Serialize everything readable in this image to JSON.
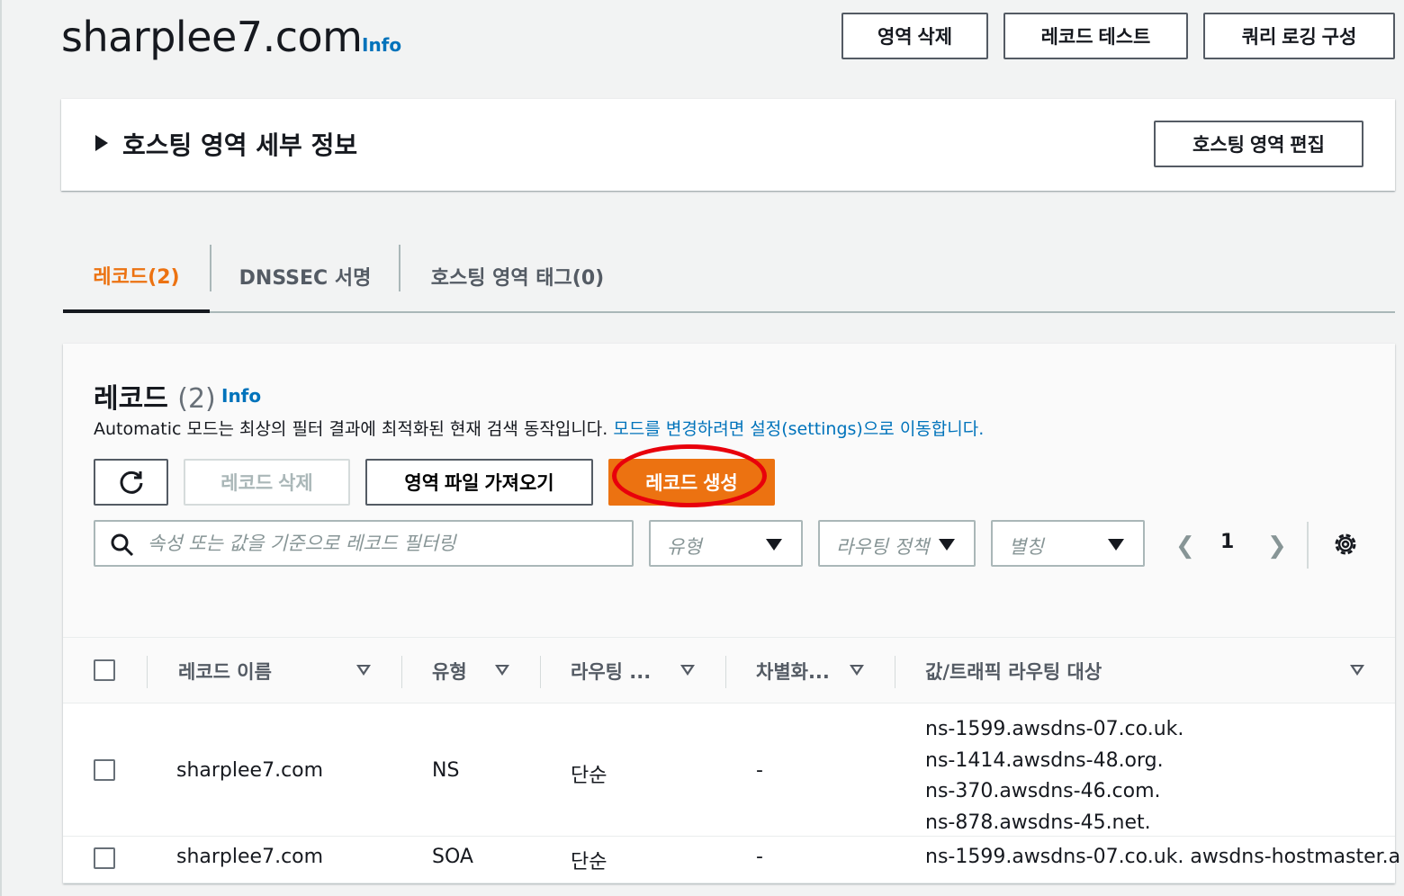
{
  "header": {
    "title": "sharplee7.com",
    "info": "Info",
    "buttons": {
      "delete_zone": "영역 삭제",
      "test_record": "레코드 테스트",
      "query_logging": "쿼리 로깅 구성"
    }
  },
  "details": {
    "title": "호스팅 영역 세부 정보",
    "edit_button": "호스팅 영역 편집"
  },
  "tabs": [
    {
      "label": "레코드(2)",
      "active": true
    },
    {
      "label": "DNSSEC 서명",
      "active": false
    },
    {
      "label": "호스팅 영역 태그(0)",
      "active": false
    }
  ],
  "records": {
    "heading": "레코드",
    "count": "(2)",
    "info": "Info",
    "description": "Automatic 모드는 최상의 필터 결과에 최적화된 현재 검색 동작입니다. ",
    "description_link": "모드를 변경하려면 설정(settings)으로 이동합니다.",
    "buttons": {
      "delete": "레코드 삭제",
      "import": "영역 파일 가져오기",
      "create": "레코드 생성"
    },
    "search_placeholder": "속성 또는 값을 기준으로 레코드 필터링",
    "filters": {
      "type": "유형",
      "routing": "라우팅 정책",
      "alias": "별칭"
    },
    "pager": {
      "page": "1"
    },
    "columns": {
      "name": "레코드 이름",
      "type": "유형",
      "routing": "라우팅 ...",
      "differentiator": "차별화...",
      "value": "값/트래픽 라우팅 대상"
    },
    "rows": [
      {
        "name": "sharplee7.com",
        "type": "NS",
        "routing": "단순",
        "differentiator": "-",
        "values": [
          "ns-1599.awsdns-07.co.uk.",
          "ns-1414.awsdns-48.org.",
          "ns-370.awsdns-46.com.",
          "ns-878.awsdns-45.net."
        ]
      },
      {
        "name": "sharplee7.com",
        "type": "SOA",
        "routing": "단순",
        "differentiator": "-",
        "value": "ns-1599.awsdns-07.co.uk. awsdns-hostmaster.a"
      }
    ]
  },
  "colors": {
    "accent": "#ec7211",
    "link": "#0073bb",
    "highlight": "#e8000b"
  }
}
